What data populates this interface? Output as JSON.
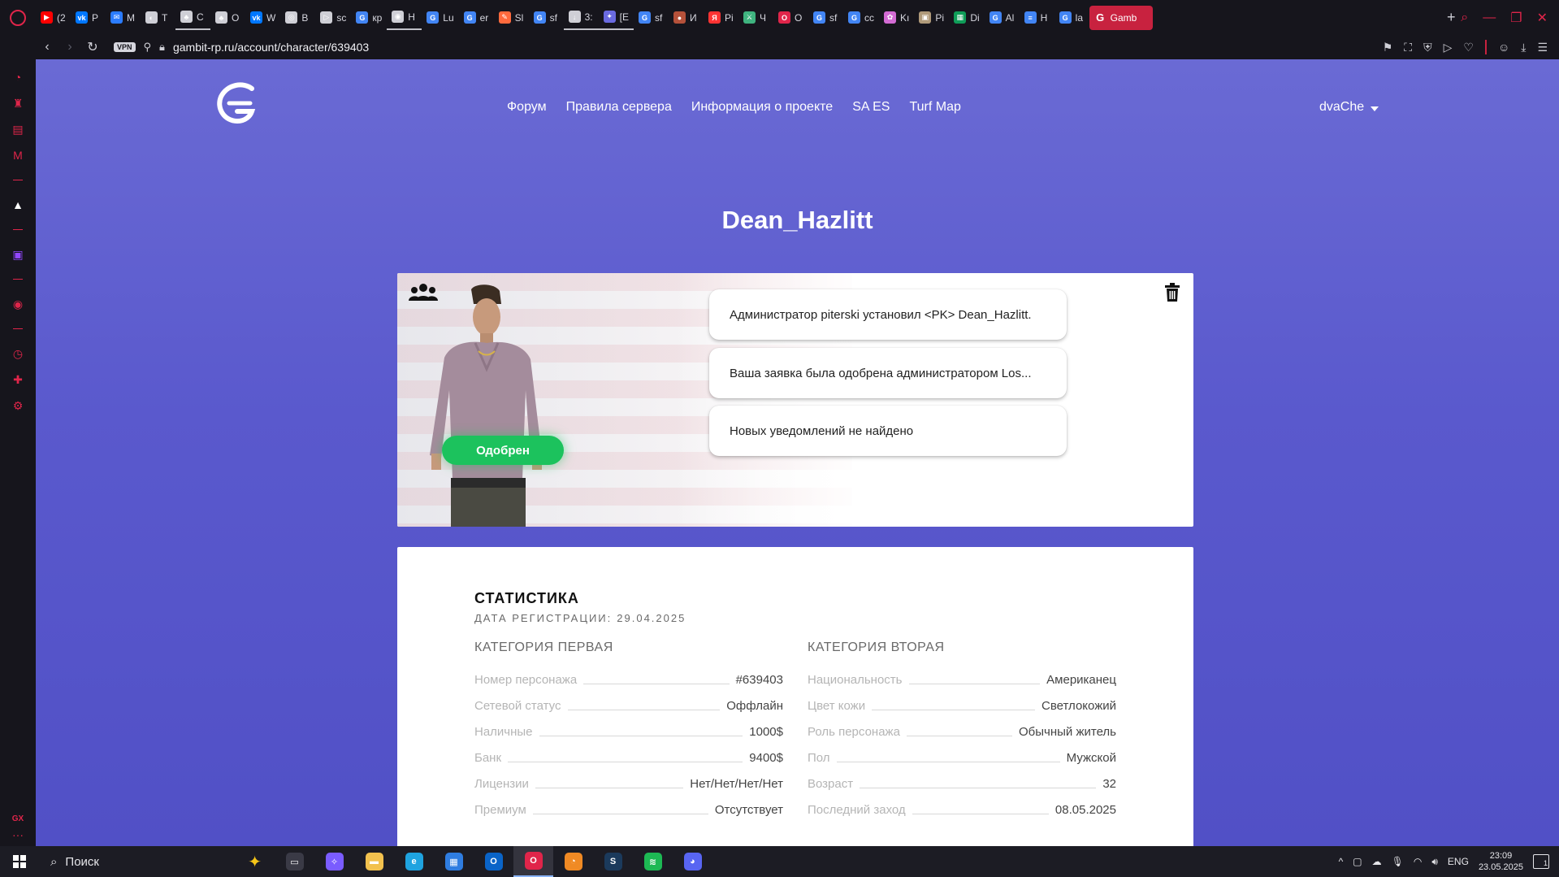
{
  "browser": {
    "tabs": [
      {
        "label": "(2",
        "icon": "youtube-icon",
        "color": "#ff0000",
        "glyph": "▶"
      },
      {
        "label": "P",
        "icon": "vk-icon",
        "color": "#0077ff",
        "glyph": "vk"
      },
      {
        "label": "M",
        "icon": "chat-icon",
        "color": "#2b7cff",
        "glyph": "✉"
      },
      {
        "label": "T",
        "icon": "globe-icon",
        "color": "#cfcfd6",
        "glyph": "◐"
      },
      {
        "label": "C",
        "icon": "crowd-icon",
        "color": "#cfcfd6",
        "glyph": "♣"
      },
      {
        "label": "O",
        "icon": "crowd-icon",
        "color": "#cfcfd6",
        "glyph": "♣"
      },
      {
        "label": "W",
        "icon": "vk-icon",
        "color": "#0077ff",
        "glyph": "vk"
      },
      {
        "label": "B",
        "icon": "target-icon",
        "color": "#cfcfd6",
        "glyph": "◎"
      },
      {
        "label": "sc",
        "icon": "play-icon",
        "color": "#cfcfd6",
        "glyph": "▷"
      },
      {
        "label": "кр",
        "icon": "google-icon",
        "color": "#4285f4",
        "glyph": "G"
      },
      {
        "label": "H",
        "icon": "eye-icon",
        "color": "#cfcfd6",
        "glyph": "◉"
      },
      {
        "label": "Lu",
        "icon": "google-icon",
        "color": "#4285f4",
        "glyph": "G"
      },
      {
        "label": "er",
        "icon": "google-icon",
        "color": "#4285f4",
        "glyph": "G"
      },
      {
        "label": "Sl",
        "icon": "brush-icon",
        "color": "#ff6a3d",
        "glyph": "✎"
      },
      {
        "label": "sf",
        "icon": "google-icon",
        "color": "#4285f4",
        "glyph": "G"
      },
      {
        "label": "3:",
        "icon": "download-icon",
        "color": "#cfcfd6",
        "glyph": "↓"
      },
      {
        "label": "[E",
        "icon": "badge-icon",
        "color": "#6a6ae0",
        "glyph": "✦"
      },
      {
        "label": "sf",
        "icon": "google-icon",
        "color": "#4285f4",
        "glyph": "G"
      },
      {
        "label": "И",
        "icon": "avatar-icon",
        "color": "#b5513a",
        "glyph": "●"
      },
      {
        "label": "Pi",
        "icon": "yandex-icon",
        "color": "#ff3333",
        "glyph": "Я"
      },
      {
        "label": "Ч",
        "icon": "sword-icon",
        "color": "#3fb37f",
        "glyph": "⚔"
      },
      {
        "label": "O",
        "icon": "opera-icon",
        "color": "#e0254a",
        "glyph": "O"
      },
      {
        "label": "sf",
        "icon": "google-icon",
        "color": "#4285f4",
        "glyph": "G"
      },
      {
        "label": "cc",
        "icon": "google-icon",
        "color": "#4285f4",
        "glyph": "G"
      },
      {
        "label": "Kı",
        "icon": "butterfly-icon",
        "color": "#d36bd3",
        "glyph": "✿"
      },
      {
        "label": "Pi",
        "icon": "portrait-icon",
        "color": "#b09a7a",
        "glyph": "▣"
      },
      {
        "label": "Di",
        "icon": "sheets-icon",
        "color": "#0f9d58",
        "glyph": "▦"
      },
      {
        "label": "Al",
        "icon": "google-icon",
        "color": "#4285f4",
        "glyph": "G"
      },
      {
        "label": "H",
        "icon": "docs-icon",
        "color": "#4285f4",
        "glyph": "≡"
      },
      {
        "label": "la",
        "icon": "google-icon",
        "color": "#4285f4",
        "glyph": "G"
      }
    ],
    "active_tab": {
      "label": "Gamb",
      "icon": "gambit-icon"
    },
    "url_host": "gambit-rp.ru",
    "url_path": "/account/character/639403",
    "vpn_label": "VPN"
  },
  "site": {
    "nav": [
      "Форум",
      "Правила сервера",
      "Информация о проекте",
      "SA ES",
      "Turf Map"
    ],
    "username": "dvaChe"
  },
  "character": {
    "name": "Dean_Hazlitt",
    "status": "Одобрен",
    "status_color": "#1cc25d",
    "notifications": [
      "Администратор piterski установил <PK> Dean_Hazlitt.",
      "Ваша заявка была одобрена администратором Los...",
      "Новых уведомлений не найдено"
    ]
  },
  "stats": {
    "title": "СТАТИСТИКА",
    "reg_label": "ДАТА РЕГИСТРАЦИИ:",
    "reg_date": "29.04.2025",
    "cat1": {
      "title": "КАТЕГОРИЯ ПЕРВАЯ",
      "rows": [
        {
          "label": "Номер персонажа",
          "value": "#639403"
        },
        {
          "label": "Сетевой статус",
          "value": "Оффлайн"
        },
        {
          "label": "Наличные",
          "value": "1000$"
        },
        {
          "label": "Банк",
          "value": "9400$"
        },
        {
          "label": "Лицензии",
          "value": "Нет/Нет/Нет/Нет"
        },
        {
          "label": "Премиум",
          "value": "Отсутствует"
        }
      ]
    },
    "cat2": {
      "title": "КАТЕГОРИЯ ВТОРАЯ",
      "rows": [
        {
          "label": "Национальность",
          "value": "Американец"
        },
        {
          "label": "Цвет кожи",
          "value": "Светлокожий"
        },
        {
          "label": "Роль персонажа",
          "value": "Обычный житель"
        },
        {
          "label": "Пол",
          "value": "Мужской"
        },
        {
          "label": "Возраст",
          "value": "32"
        },
        {
          "label": "Последний заход",
          "value": "08.05.2025"
        }
      ]
    }
  },
  "taskbar": {
    "search_placeholder": "Поиск",
    "apps": [
      {
        "name": "task-view-icon",
        "color": "#3a3a46",
        "glyph": "▭"
      },
      {
        "name": "copilot-icon",
        "color": "#7a5cff",
        "glyph": "✧"
      },
      {
        "name": "file-explorer-icon",
        "color": "#f2c14e",
        "glyph": "▬"
      },
      {
        "name": "edge-icon",
        "color": "#1fa3e0",
        "glyph": "e"
      },
      {
        "name": "store-icon",
        "color": "#2f7de1",
        "glyph": "▦"
      },
      {
        "name": "outlook-icon",
        "color": "#0a64c8",
        "glyph": "O"
      },
      {
        "name": "opera-gx-icon",
        "color": "#e0254a",
        "glyph": "O"
      },
      {
        "name": "blender-icon",
        "color": "#f08a24",
        "glyph": "◔"
      },
      {
        "name": "steam-icon",
        "color": "#1b3a5c",
        "glyph": "S"
      },
      {
        "name": "spotify-icon",
        "color": "#1db954",
        "glyph": "≋"
      },
      {
        "name": "discord-icon",
        "color": "#5865f2",
        "glyph": "◕"
      }
    ],
    "active_app": 6,
    "lang": "ENG",
    "time": "23:09",
    "date": "23.05.2025",
    "notif_count": "1"
  }
}
